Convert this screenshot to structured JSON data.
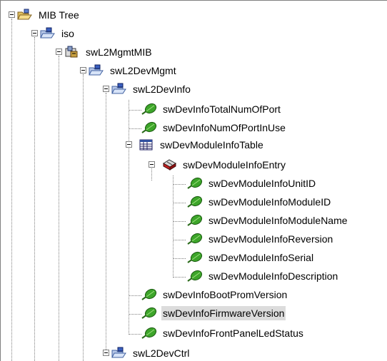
{
  "tree": {
    "selected": "swDevInfoFirmwareVersion",
    "nodes": [
      {
        "label": "MIB Tree",
        "icon": "folder-open-icon",
        "expanded": true
      },
      {
        "label": "iso",
        "icon": "folder-open-icon",
        "expanded": true
      },
      {
        "label": "swL2MgmtMIB",
        "icon": "module-icon",
        "expanded": true
      },
      {
        "label": "swL2DevMgmt",
        "icon": "folder-open-icon",
        "expanded": true
      },
      {
        "label": "swL2DevInfo",
        "icon": "folder-open-icon",
        "expanded": true
      },
      {
        "label": "swDevInfoTotalNumOfPort",
        "icon": "leaf-icon"
      },
      {
        "label": "swDevInfoNumOfPortInUse",
        "icon": "leaf-icon"
      },
      {
        "label": "swDevModuleInfoTable",
        "icon": "table-icon",
        "expanded": true
      },
      {
        "label": "swDevModuleInfoEntry",
        "icon": "entry-icon",
        "expanded": true
      },
      {
        "label": "swDevModuleInfoUnitID",
        "icon": "leaf-icon"
      },
      {
        "label": "swDevModuleInfoModuleID",
        "icon": "leaf-icon"
      },
      {
        "label": "swDevModuleInfoModuleName",
        "icon": "leaf-icon"
      },
      {
        "label": "swDevModuleInfoReversion",
        "icon": "leaf-icon"
      },
      {
        "label": "swDevModuleInfoSerial",
        "icon": "leaf-icon"
      },
      {
        "label": "swDevModuleInfoDescription",
        "icon": "leaf-icon"
      },
      {
        "label": "swDevInfoBootPromVersion",
        "icon": "leaf-icon"
      },
      {
        "label": "swDevInfoFirmwareVersion",
        "icon": "leaf-icon"
      },
      {
        "label": "swDevInfoFrontPanelLedStatus",
        "icon": "leaf-icon"
      },
      {
        "label": "swL2DevCtrl",
        "icon": "folder-open-icon",
        "expanded": true
      }
    ]
  }
}
